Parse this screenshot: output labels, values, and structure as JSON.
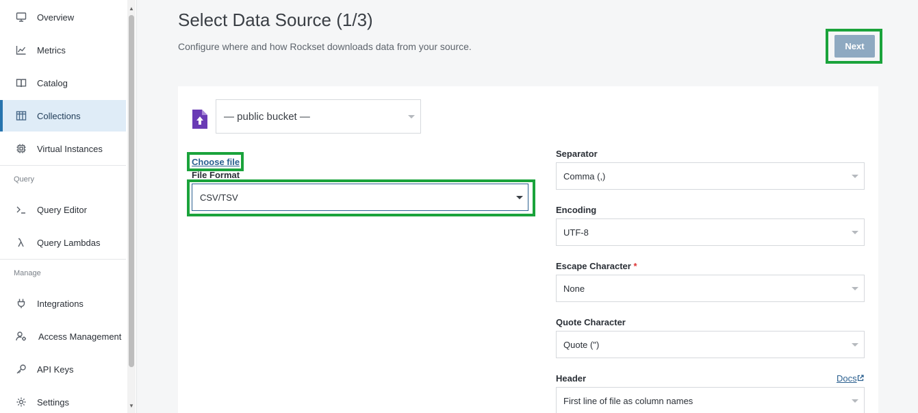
{
  "sidebar": {
    "items": [
      {
        "label": "Overview",
        "icon": "monitor-icon"
      },
      {
        "label": "Metrics",
        "icon": "line-chart-icon"
      },
      {
        "label": "Catalog",
        "icon": "book-icon"
      },
      {
        "label": "Collections",
        "icon": "table-icon",
        "active": true
      },
      {
        "label": "Virtual Instances",
        "icon": "chip-icon"
      }
    ],
    "query_section": "Query",
    "query_items": [
      {
        "label": "Query Editor",
        "icon": "terminal-icon"
      },
      {
        "label": "Query Lambdas",
        "icon": "lambda-icon"
      }
    ],
    "manage_section": "Manage",
    "manage_items": [
      {
        "label": "Integrations",
        "icon": "plug-icon"
      },
      {
        "label": "Access Management",
        "icon": "user-gear-icon"
      },
      {
        "label": "API Keys",
        "icon": "key-icon"
      },
      {
        "label": "Settings",
        "icon": "gear-icon"
      }
    ]
  },
  "header": {
    "title": "Select Data Source (1/3)",
    "subtitle": "Configure where and how Rockset downloads data from your source.",
    "next_label": "Next"
  },
  "source": {
    "bucket_value": "— public bucket —",
    "choose_file_label": "Choose file",
    "file_format_label": "File Format",
    "file_format_value": "CSV/TSV"
  },
  "options": {
    "separator_label": "Separator",
    "separator_value": "Comma (,)",
    "encoding_label": "Encoding",
    "encoding_value": "UTF-8",
    "escape_label": "Escape Character",
    "escape_required": "*",
    "escape_value": "None",
    "quote_label": "Quote Character",
    "quote_value": "Quote (\")",
    "header_label": "Header",
    "header_value": "First line of file as column names",
    "docs_label": "Docs"
  },
  "colors": {
    "accent": "#2774ae",
    "highlight": "#1aa33b",
    "next_button": "#8ea9c1",
    "upload_icon": "#6a3bb5"
  }
}
